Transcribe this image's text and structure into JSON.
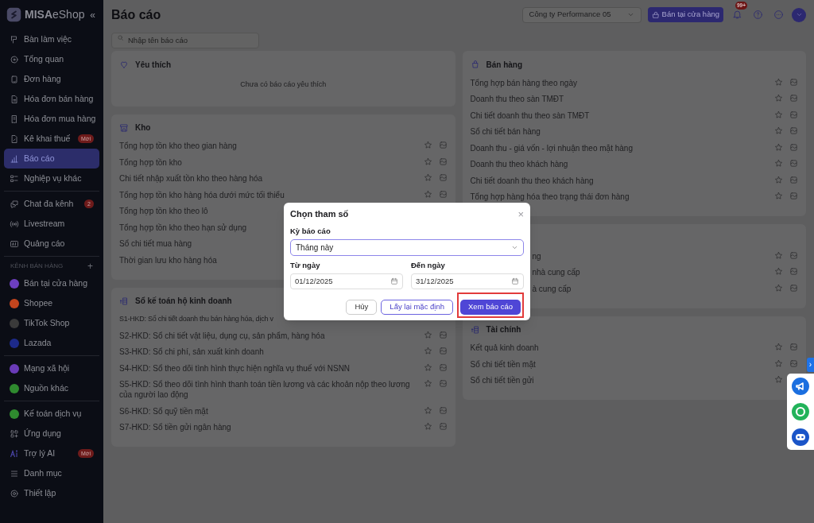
{
  "logo": {
    "brand": "MISA",
    "product": "eShop",
    "collapse": "«"
  },
  "sidebar": {
    "groups": [
      {
        "items": [
          {
            "label": "Bàn làm việc",
            "selected": false
          },
          {
            "label": "Tổng quan",
            "selected": false
          },
          {
            "label": "Đơn hàng",
            "selected": false
          },
          {
            "label": "Hóa đơn bán hàng",
            "selected": false
          },
          {
            "label": "Hóa đơn mua hàng",
            "selected": false
          },
          {
            "label": "Kê khai thuế",
            "selected": false,
            "badge": "Mới"
          },
          {
            "label": "Báo cáo",
            "selected": true
          },
          {
            "label": "Nghiệp vụ khác",
            "selected": false
          }
        ]
      },
      {
        "items": [
          {
            "label": "Chat đa kênh",
            "selected": false,
            "badge": "2"
          },
          {
            "label": "Livestream",
            "selected": false
          },
          {
            "label": "Quảng cáo",
            "selected": false
          }
        ]
      },
      {
        "header": "KÊNH BÁN HÀNG",
        "header_action": "+",
        "items": [
          {
            "label": "Bán tại cửa hàng",
            "selected": false,
            "color": "#6d3fc0"
          },
          {
            "label": "Shopee",
            "selected": false,
            "color": "#c2451e"
          },
          {
            "label": "TikTok Shop",
            "selected": false,
            "color": "#3a3a3a"
          },
          {
            "label": "Lazada",
            "selected": false,
            "color": "#1d2a8a"
          }
        ]
      },
      {
        "items": [
          {
            "label": "Mạng xã hội",
            "selected": false,
            "color": "#6a3bb8"
          },
          {
            "label": "Nguồn khác",
            "selected": false,
            "color": "#2f8a2f"
          }
        ]
      },
      {
        "items": [
          {
            "label": "Kế toán dịch vụ",
            "selected": false,
            "color": "#2f8a2f"
          },
          {
            "label": "Ứng dụng",
            "selected": false
          },
          {
            "label": "Trợ lý AI",
            "selected": false,
            "badge": "Mới"
          },
          {
            "label": "Danh mục",
            "selected": false
          },
          {
            "label": "Thiết lập",
            "selected": false
          }
        ]
      }
    ]
  },
  "header": {
    "title": "Báo cáo",
    "search": {
      "placeholder": "Nhập tên báo cáo"
    },
    "company": "Công ty Performance 05",
    "store_button": "Bán tại cửa hàng",
    "notification_count": "99+"
  },
  "columns": [
    [
      {
        "title": "Yêu thích",
        "empty_text": "Chưa có báo cáo yêu thích"
      },
      {
        "title": "Kho",
        "items": [
          {
            "label": "Tổng hợp tồn kho theo gian hàng",
            "kind": "full"
          },
          {
            "label": "Tổng hợp tồn kho",
            "kind": "full"
          },
          {
            "label": "Chi tiết nhập xuất tồn kho theo hàng hóa",
            "kind": "full"
          },
          {
            "label": "Tổng hợp tồn kho hàng hóa dưới mức tối thiểu",
            "kind": "full"
          },
          {
            "label": "Tổng hợp tồn kho theo lô",
            "kind": "covered"
          },
          {
            "label": "Tổng hợp tồn kho theo hạn sử dụng",
            "kind": "covered"
          },
          {
            "label": "Sổ chi tiết mua hàng",
            "kind": "covered"
          },
          {
            "label": "Thời gian lưu kho hàng hóa",
            "kind": "covered"
          }
        ]
      },
      {
        "title": "Sổ kế toán hộ kinh doanh",
        "items": [
          {
            "label": "S1-HKD: Sổ chi tiết doanh thu bán hàng hóa, dịch v",
            "kind": "cut"
          },
          {
            "label": "S2-HKD: Sổ chi tiết vật liệu, dụng cụ, sản phẩm, hàng hóa",
            "kind": "full"
          },
          {
            "label": "S3-HKD: Sổ chi phí, sản xuất kinh doanh",
            "kind": "full"
          },
          {
            "label": "S4-HKD: Sổ theo dõi tình hình thực hiện nghĩa vụ thuế với NSNN",
            "kind": "full"
          },
          {
            "label": "S5-HKD: Sổ theo dõi tình hình thanh toán tiền lương và các khoản nộp theo lương của người lao động",
            "kind": "full"
          },
          {
            "label": "S6-HKD: Sổ quỹ tiền mặt",
            "kind": "full"
          },
          {
            "label": "S7-HKD: Sổ tiền gửi ngân hàng",
            "kind": "full"
          }
        ]
      }
    ],
    [
      {
        "title": "Bán hàng",
        "items": [
          {
            "label": "Tổng hợp bán hàng theo ngày",
            "kind": "full"
          },
          {
            "label": "Doanh thu theo sàn TMĐT",
            "kind": "full"
          },
          {
            "label": "Chi tiết doanh thu theo sàn TMĐT",
            "kind": "full"
          },
          {
            "label": "Sổ chi tiết bán hàng",
            "kind": "full"
          },
          {
            "label": "Doanh thu - giá vốn - lợi nhuận theo mặt hàng",
            "kind": "full"
          },
          {
            "label": "Doanh thu theo khách hàng",
            "kind": "full"
          },
          {
            "label": "Chi tiết doanh thu theo khách hàng",
            "kind": "full"
          },
          {
            "label": "Tổng hợp hàng hóa theo trạng thái đơn hàng",
            "kind": "full"
          }
        ]
      },
      {
        "items": [
          {
            "label": "ng",
            "kind": "fragment"
          },
          {
            "label": "nhà cung cấp",
            "kind": "fragment"
          },
          {
            "label": "à cung cấp",
            "kind": "fragment"
          }
        ]
      },
      {
        "title": "Tài chính",
        "items": [
          {
            "label": "Kết quả kinh doanh",
            "kind": "full"
          },
          {
            "label": "Sổ chi tiết tiền mặt",
            "kind": "full"
          },
          {
            "label": "Sổ chi tiết tiền gửi",
            "kind": "full"
          }
        ]
      }
    ]
  ],
  "dialog": {
    "title": "Chọn tham số",
    "close": "×",
    "period_label": "Kỳ báo cáo",
    "period_value": "Tháng này",
    "from_label": "Từ ngày",
    "from_value": "01/12/2025",
    "to_label": "Đến ngày",
    "to_value": "31/12/2025",
    "buttons": [
      {
        "label": "Hủy",
        "kind": "plain",
        "highlighted": false
      },
      {
        "label": "Lấy lại mặc định",
        "kind": "outline",
        "highlighted": false
      },
      {
        "label": "Xem báo cáo",
        "kind": "primary",
        "highlighted": true
      }
    ]
  },
  "side_widget": {
    "toggle": "›"
  }
}
